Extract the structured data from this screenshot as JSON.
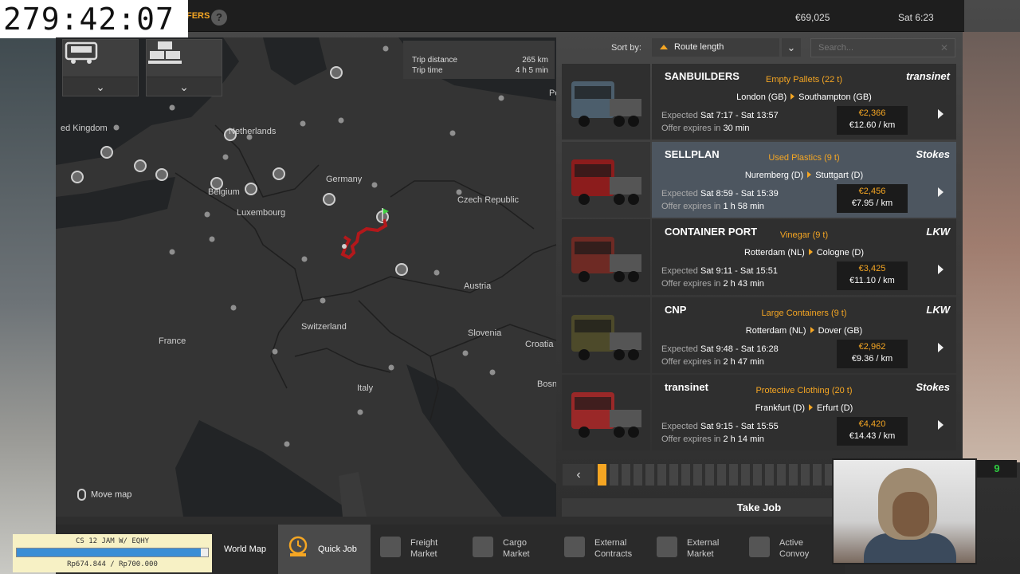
{
  "stream_timer": "279:42:07",
  "top_bar": {
    "offers_label": "FERS",
    "help_icon": "question-icon",
    "money": "€69,025",
    "time": "Sat 6:23"
  },
  "map": {
    "filter_icons": [
      "truck-icon",
      "cargo-icon"
    ],
    "trip_distance_label": "Trip distance",
    "trip_distance_value": "265 km",
    "trip_time_label": "Trip time",
    "trip_time_value": "4 h 5 min",
    "labels": {
      "uk": "ed Kingdom",
      "netherlands": "Netherlands",
      "germany": "Germany",
      "belgium": "Belgium",
      "luxembourg": "Luxembourg",
      "czech": "Czech Republic",
      "austria": "Austria",
      "switzerland": "Switzerland",
      "france": "France",
      "slovenia": "Slovenia",
      "croatia": "Croatia",
      "italy": "Italy",
      "bosnia": "Bosn",
      "po": "Po"
    },
    "move_map": "Move map"
  },
  "jobs_panel": {
    "sort_label": "Sort by:",
    "sort_value": "Route length",
    "search_placeholder": "Search...",
    "expected_label": "Expected",
    "expires_label": "Offer expires in",
    "jobs": [
      {
        "company": "SANBUILDERS",
        "cargo": "Empty Pallets (22 t)",
        "from": "London (GB)",
        "to": "Southampton (GB)",
        "client": "transinet",
        "expected": "Sat 7:17 - Sat 13:57",
        "expires": "30 min",
        "price": "€2,366",
        "rate": "€12.60 / km",
        "truck_color": "#4c5e6c"
      },
      {
        "company": "SELLPLAN",
        "cargo": "Used Plastics (9 t)",
        "from": "Nuremberg (D)",
        "to": "Stuttgart (D)",
        "client": "Stokes",
        "expected": "Sat 8:59 - Sat 15:39",
        "expires": "1 h 58 min",
        "price": "€2,456",
        "rate": "€7.95 / km",
        "truck_color": "#8c1c1c"
      },
      {
        "company": "CONTAINER PORT",
        "cargo": "Vinegar (9 t)",
        "from": "Rotterdam (NL)",
        "to": "Cologne (D)",
        "client": "LKW",
        "expected": "Sat 9:11 - Sat 15:51",
        "expires": "2 h 43 min",
        "price": "€3,425",
        "rate": "€11.10 / km",
        "truck_color": "#6e2a24"
      },
      {
        "company": "CNP",
        "cargo": "Large Containers (9 t)",
        "from": "Rotterdam (NL)",
        "to": "Dover (GB)",
        "client": "LKW",
        "expected": "Sat 9:48 - Sat 16:28",
        "expires": "2 h 47 min",
        "price": "€2,962",
        "rate": "€9.36 / km",
        "truck_color": "#4d4a2a"
      },
      {
        "company": "transinet",
        "cargo": "Protective Clothing (20 t)",
        "from": "Frankfurt (D)",
        "to": "Erfurt (D)",
        "client": "Stokes",
        "expected": "Sat 9:15 - Sat 15:55",
        "expires": "2 h 14 min",
        "price": "€4,420",
        "rate": "€14.43 / km",
        "truck_color": "#9a2828"
      }
    ],
    "take_job": "Take Job"
  },
  "bottom_nav": [
    {
      "label": "World Map",
      "icon": ""
    },
    {
      "label": "Quick Job",
      "icon": "clock-icon"
    },
    {
      "label": "Freight\nMarket",
      "icon": "boxes-icon"
    },
    {
      "label": "Cargo\nMarket",
      "icon": "crate-icon"
    },
    {
      "label": "External\nContracts",
      "icon": "globe-icon"
    },
    {
      "label": "External\nMarket",
      "icon": "globe-icon"
    },
    {
      "label": "Active\nConvoy",
      "icon": "convoy-icon"
    }
  ],
  "overlay": {
    "goal_title": "CS 12 JAM W/ EQHY",
    "goal_amount": "Rp674.844 / Rp700.000",
    "goal_progress": 0.964,
    "cam_badge": "9"
  }
}
